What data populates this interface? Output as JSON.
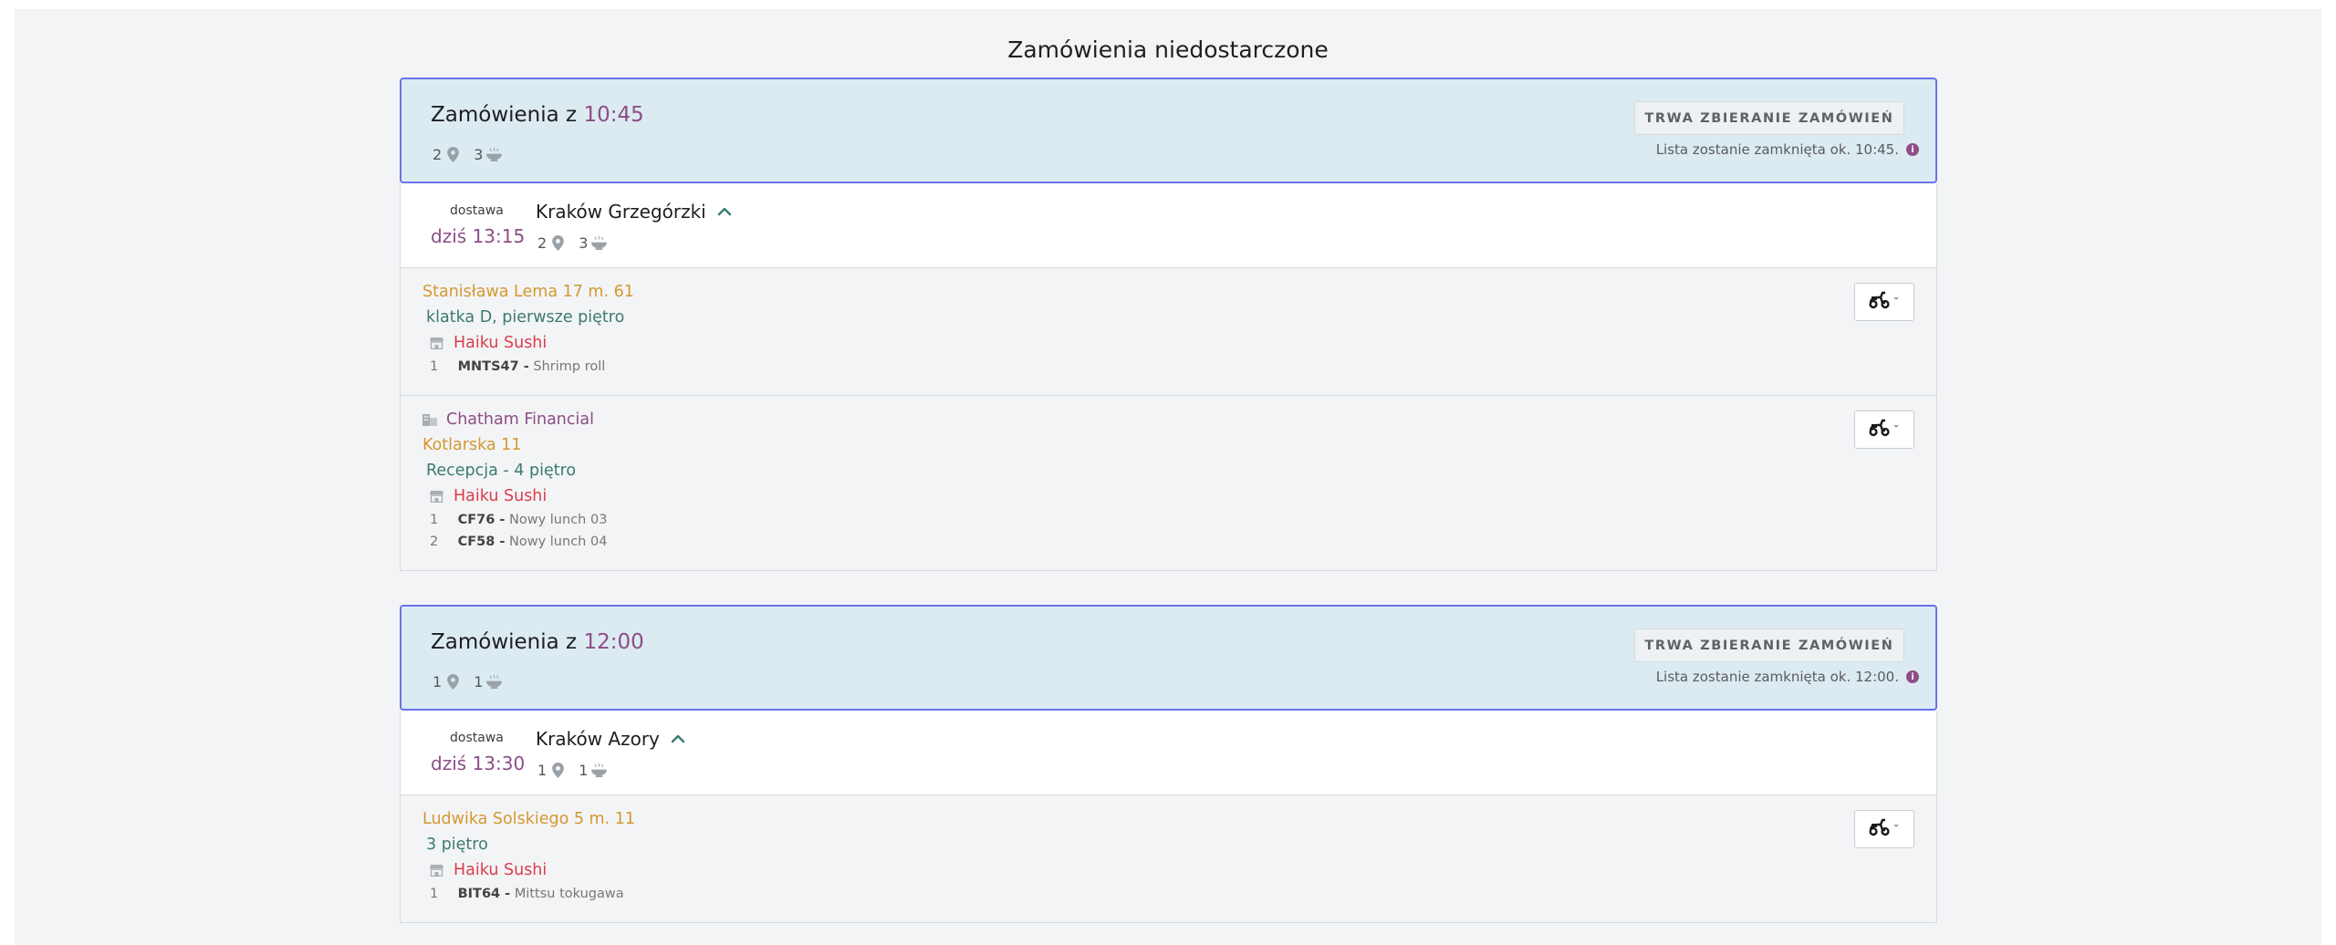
{
  "page_title": "Zamówienia niedostarczone",
  "colors": {
    "accent": "#8d4e86",
    "group_header_bg": "#dcebf2",
    "group_border": "#6b72ea",
    "address": "#d4982f",
    "detail": "#3c7a72",
    "restaurant": "#dc3d4b"
  },
  "groups": [
    {
      "title_prefix": "Zamówienia z",
      "time": "10:45",
      "locations": "2",
      "meals": "3",
      "collect_label": "TRWA ZBIERANIE ZAMÓWIEŃ",
      "close_note": "Lista zostanie zamknięta ok. 10:45.",
      "route": {
        "delivery_label": "dostawa",
        "delivery_time": "dziś 13:15",
        "name": "Kraków Grzegórzki",
        "locations": "2",
        "meals": "3"
      },
      "orders": [
        {
          "address": "Stanisława Lema 17 m. 61",
          "details": "klatka D, pierwsze piętro",
          "restaurant": "Haiku Sushi",
          "items": [
            {
              "qty": "1",
              "code": "MNTS47 -",
              "name": "Shrimp roll"
            }
          ]
        },
        {
          "company": "Chatham Financial",
          "address": "Kotlarska 11",
          "details": "Recepcja - 4 piętro",
          "restaurant": "Haiku Sushi",
          "items": [
            {
              "qty": "1",
              "code": "CF76 -",
              "name": "Nowy lunch 03"
            },
            {
              "qty": "2",
              "code": "CF58 -",
              "name": "Nowy lunch 04"
            }
          ]
        }
      ]
    },
    {
      "title_prefix": "Zamówienia z",
      "time": "12:00",
      "locations": "1",
      "meals": "1",
      "collect_label": "TRWA ZBIERANIE ZAMÓWIEŃ",
      "close_note": "Lista zostanie zamknięta ok. 12:00.",
      "route": {
        "delivery_label": "dostawa",
        "delivery_time": "dziś 13:30",
        "name": "Kraków Azory",
        "locations": "1",
        "meals": "1"
      },
      "orders": [
        {
          "address": "Ludwika Solskiego 5 m. 11",
          "details": "3 piętro",
          "restaurant": "Haiku Sushi",
          "items": [
            {
              "qty": "1",
              "code": "BIT64 -",
              "name": "Mittsu tokugawa"
            }
          ]
        }
      ]
    }
  ],
  "icons": {
    "location": "map-pin-icon",
    "meal": "bowl-icon",
    "restaurant": "storefront-icon",
    "company": "building-icon",
    "courier": "scooter-icon",
    "expand": "chevron-up-icon",
    "info": "info-icon"
  }
}
